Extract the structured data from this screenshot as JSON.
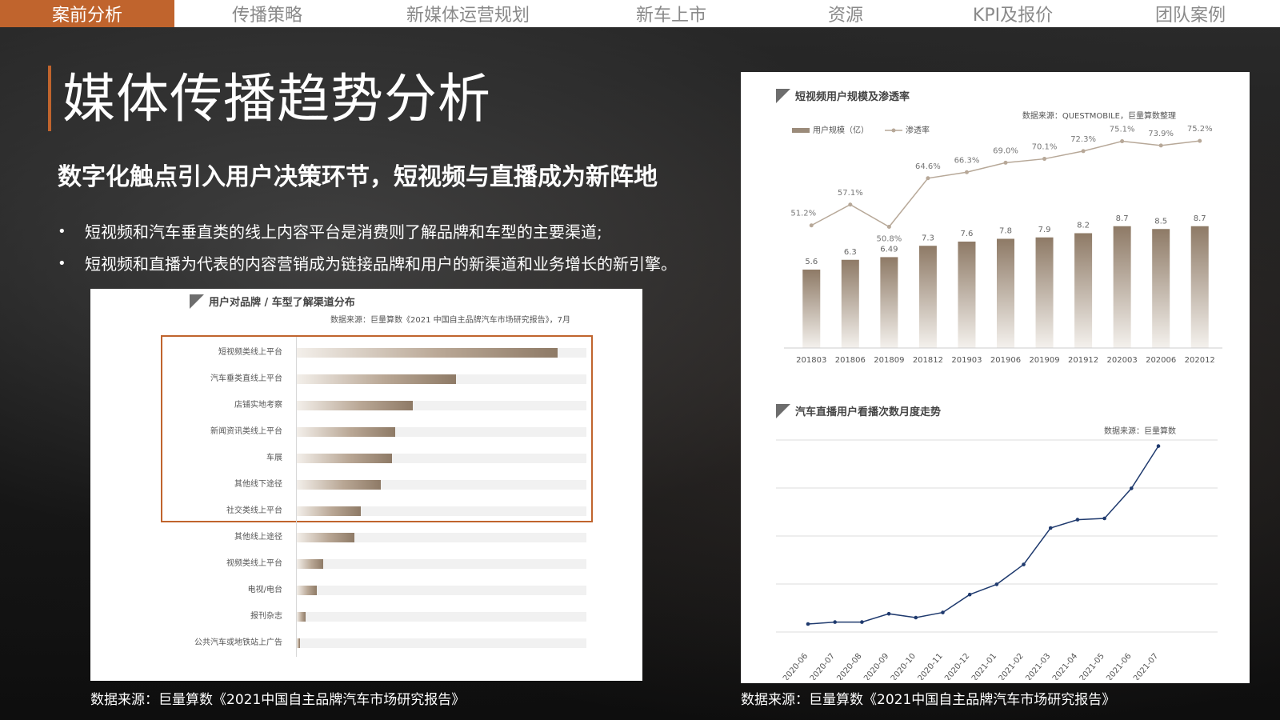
{
  "nav": {
    "items": [
      {
        "label": "案前分析",
        "active": true
      },
      {
        "label": "传播策略",
        "active": false
      },
      {
        "label": "新媒体运营规划",
        "active": false
      },
      {
        "label": "新车上市",
        "active": false
      },
      {
        "label": "资源",
        "active": false
      },
      {
        "label": "KPI及报价",
        "active": false
      },
      {
        "label": "团队案例",
        "active": false
      }
    ]
  },
  "page": {
    "title": "媒体传播趋势分析",
    "subtitle": "数字化触点引入用户决策环节，短视频与直播成为新阵地",
    "bullets": [
      "短视频和汽车垂直类的线上内容平台是消费则了解品牌和车型的主要渠道;",
      "短视频和直播为代表的内容营销成为链接品牌和用户的新渠道和业务增长的新引擎。"
    ],
    "bullet_symbol": "•",
    "left_source": "数据来源：巨量算数《2021中国自主品牌汽车市场研究报告》",
    "right_source": "数据来源：巨量算数《2021中国自主品牌汽车市场研究报告》"
  },
  "colors": {
    "accent": "#c0642d",
    "bar_dark": "#8e7a66",
    "line_blue": "#1f3a6e",
    "penetration_line": "#b7a898"
  },
  "chart_data": [
    {
      "type": "bar",
      "orientation": "horizontal",
      "title": "用户对品牌 / 车型了解渠道分布",
      "source": "数据来源：巨量算数《2021 中国自主品牌汽车市场研究报告》，7月",
      "categories": [
        "短视频类线上平台",
        "汽车垂类直线上平台",
        "店铺实地考察",
        "新闻资讯类线上平台",
        "车展",
        "其他线下途径",
        "社交类线上平台",
        "其他线上途径",
        "视频类线上平台",
        "电视/电台",
        "报刊杂志",
        "公共汽车或地铁站上广告"
      ],
      "values": [
        90,
        55,
        40,
        34,
        33,
        29,
        22,
        20,
        9,
        7,
        3,
        1
      ],
      "xlim": [
        0,
        100
      ],
      "highlight_top_n": 7
    },
    {
      "type": "bar",
      "title": "短视频用户规模及渗透率",
      "source": "数据来源：QUESTMOBILE，巨量算数整理",
      "legend": [
        "用户规模（亿）",
        "渗透率"
      ],
      "categories": [
        "201803",
        "201806",
        "201809",
        "201812",
        "201903",
        "201906",
        "201909",
        "201912",
        "202003",
        "202006",
        "202012"
      ],
      "series": [
        {
          "name": "用户规模（亿）",
          "type": "bar",
          "values": [
            5.6,
            6.3,
            6.49,
            7.3,
            7.6,
            7.8,
            7.9,
            8.2,
            8.7,
            8.5,
            8.7
          ],
          "labels": [
            "5.6",
            "6.3",
            "6.49",
            "7.3",
            "7.6",
            "7.8",
            "7.9",
            "8.2",
            "8.7",
            "8.5",
            "8.7"
          ]
        },
        {
          "name": "渗透率",
          "type": "line",
          "values": [
            51.2,
            57.1,
            50.8,
            64.6,
            66.3,
            69.0,
            70.1,
            72.3,
            75.1,
            73.9,
            75.2
          ],
          "labels": [
            "51.2%",
            "57.1%",
            "50.8%",
            "64.6%",
            "66.3%",
            "69.0%",
            "70.1%",
            "72.3%",
            "75.1%",
            "73.9%",
            "75.2%"
          ]
        }
      ],
      "ylim_bar": [
        0,
        10
      ],
      "ylim_line": [
        30,
        80
      ]
    },
    {
      "type": "line",
      "title": "汽车直播用户看播次数月度走势",
      "source": "数据来源：巨量算数",
      "categories": [
        "2020-06",
        "2020-07",
        "2020-08",
        "2020-09",
        "2020-10",
        "2020-11",
        "2020-12",
        "2021-01",
        "2021-02",
        "2021-03",
        "2021-04",
        "2021-05",
        "2021-06",
        "2021-07"
      ],
      "values": [
        5,
        8,
        8,
        21,
        15,
        23,
        51,
        67,
        98,
        155,
        168,
        170,
        217,
        283
      ],
      "ylim": [
        0,
        300
      ],
      "grid": true
    }
  ]
}
